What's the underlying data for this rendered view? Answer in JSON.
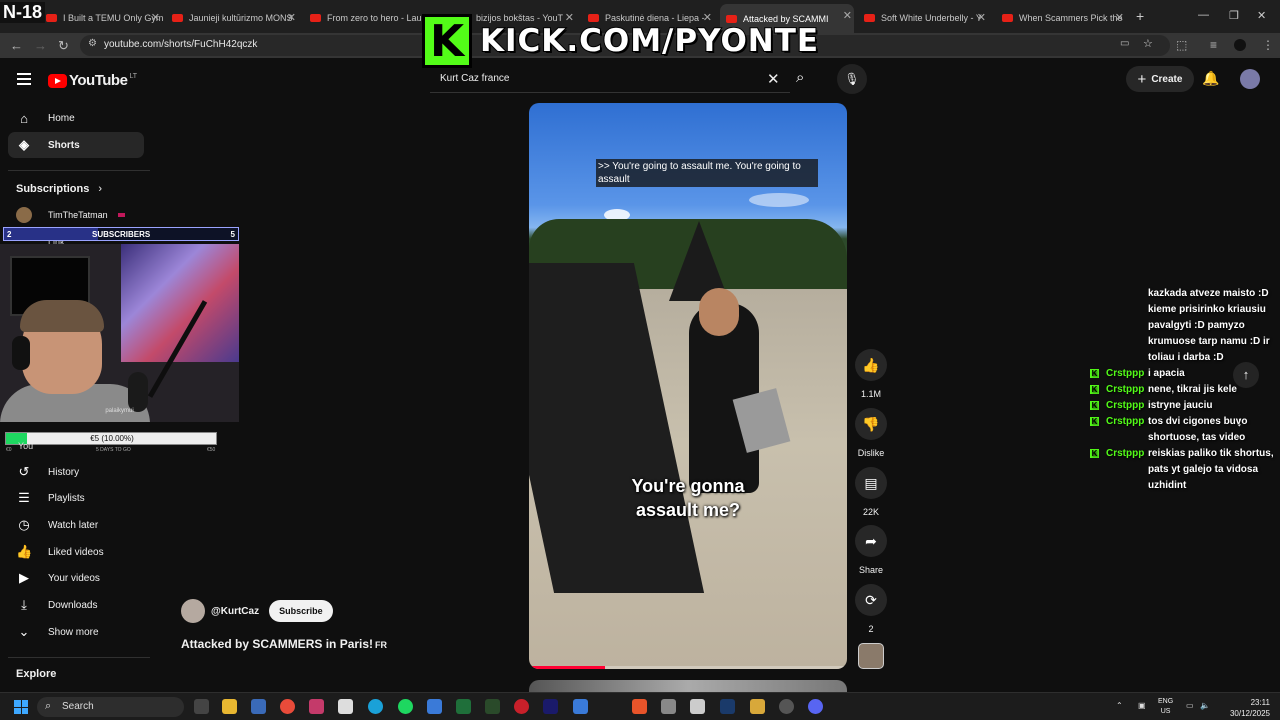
{
  "overlay": {
    "age_rating": "N-18",
    "kick_url": "KICK.COM/PYONTE",
    "kick_logo_letter": "K"
  },
  "browser": {
    "tabs": [
      {
        "title": "I Built a TEMU Only Gym",
        "active": false
      },
      {
        "title": "Jaunieji kultūrizmo MONS",
        "active": false
      },
      {
        "title": "From zero to hero - Laur",
        "active": false
      },
      {
        "title": "bizijos bokštas - YouT",
        "active": false
      },
      {
        "title": "Paskutinė diena - Liepa -",
        "active": false
      },
      {
        "title": "Attacked by SCAMMI",
        "active": true
      },
      {
        "title": "Soft White Underbelly - Y",
        "active": false
      },
      {
        "title": "When Scammers Pick the",
        "active": false
      }
    ],
    "url": "youtube.com/shorts/FuChH42qczk"
  },
  "header": {
    "logo_text": "YouTube",
    "logo_country": "LT",
    "search_value": "Kurt Caz france",
    "create_label": "Create"
  },
  "sidebar": {
    "items": [
      {
        "label": "Home",
        "icon": "home-icon"
      },
      {
        "label": "Shorts",
        "icon": "shorts-icon"
      }
    ],
    "subscriptions_label": "Subscriptions",
    "subscriptions": [
      {
        "name": "TimTheTatman"
      },
      {
        "name": "Link"
      }
    ],
    "you_label": "You",
    "you_items": [
      {
        "label": "History",
        "icon": "history-icon"
      },
      {
        "label": "Playlists",
        "icon": "playlists-icon"
      },
      {
        "label": "Watch later",
        "icon": "clock-icon"
      },
      {
        "label": "Liked videos",
        "icon": "thumbs-up-icon"
      },
      {
        "label": "Your videos",
        "icon": "video-icon"
      },
      {
        "label": "Downloads",
        "icon": "download-icon"
      },
      {
        "label": "Show more",
        "icon": "chevron-down-icon"
      }
    ],
    "explore_label": "Explore"
  },
  "stream_widgets": {
    "subscriber_goal": {
      "current": "2",
      "label": "SUBSCRIBERS",
      "target": "5",
      "progress": 0.4
    },
    "webcam_name": "palaikymui",
    "donation_goal": {
      "text": "€5 (10.00%)",
      "progress": 0.1,
      "min_label": "€0",
      "days_label": "5 DAYS TO GO",
      "max_label": "€50"
    }
  },
  "video": {
    "caption_top": ">> You're going to assault me. You're going to assault",
    "caption_main_line1": "You're gonna",
    "caption_main_line2": "assault me?",
    "channel": "@KurtCaz",
    "subscribe_label": "Subscribe",
    "title": "Attacked by SCAMMERS in Paris!",
    "title_flag": "FR",
    "progress": 0.24
  },
  "actions": {
    "likes": "1.1M",
    "dislike_label": "Dislike",
    "comments": "22K",
    "share_label": "Share",
    "remix_count": "2"
  },
  "chat": {
    "messages": [
      {
        "user": "",
        "text": "kazkada atveze maisto :D kieme prisirinko kriausiu pavalgyti :D pamyzo krumuose tarp namu :D ir toliau i darba :D"
      },
      {
        "user": "Crstppp",
        "text": "i apacia"
      },
      {
        "user": "Crstppp",
        "text": "nene, tikrai jis kele"
      },
      {
        "user": "Crstppp",
        "text": "istryne jauciu"
      },
      {
        "user": "Crstppp",
        "text": "tos dvi cigones buvo shortuose, tas video"
      },
      {
        "user": "Crstppp",
        "text": "reiskias paliko tik shortus, pats yt galejo ta vidosa uzhidint"
      }
    ]
  },
  "taskbar": {
    "search_placeholder": "Search",
    "lang_line1": "ENG",
    "lang_line2": "US",
    "time": "23:11",
    "date": "30/12/2025"
  }
}
